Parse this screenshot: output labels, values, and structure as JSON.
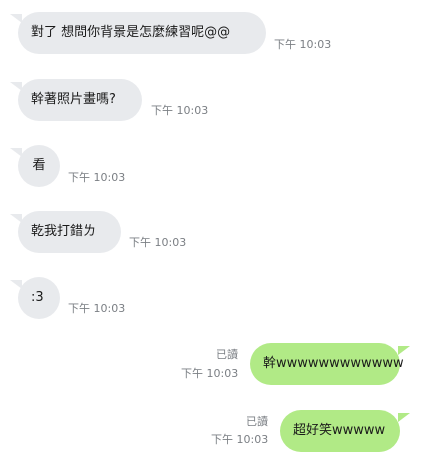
{
  "messages": [
    {
      "direction": "incoming",
      "text": "對了 想問你背景是怎麼練習呢@@",
      "time": "下午 10:03"
    },
    {
      "direction": "incoming",
      "text": "幹著照片畫嗎?",
      "time": "下午 10:03"
    },
    {
      "direction": "incoming",
      "text": "看",
      "time": "下午 10:03"
    },
    {
      "direction": "incoming",
      "text": "乾我打錯ㄌ",
      "time": "下午 10:03"
    },
    {
      "direction": "incoming",
      "text": ":3",
      "time": "下午 10:03"
    },
    {
      "direction": "outgoing",
      "text": "幹wwwwwwwwwwww",
      "read_status": "已讀",
      "time": "下午 10:03"
    },
    {
      "direction": "outgoing",
      "text": "超好笑wwwww",
      "read_status": "已讀",
      "time": "下午 10:03"
    }
  ],
  "colors": {
    "incoming_bubble": "#e8eaed",
    "outgoing_bubble": "#b1ea86",
    "meta_text": "#7b7f84"
  }
}
